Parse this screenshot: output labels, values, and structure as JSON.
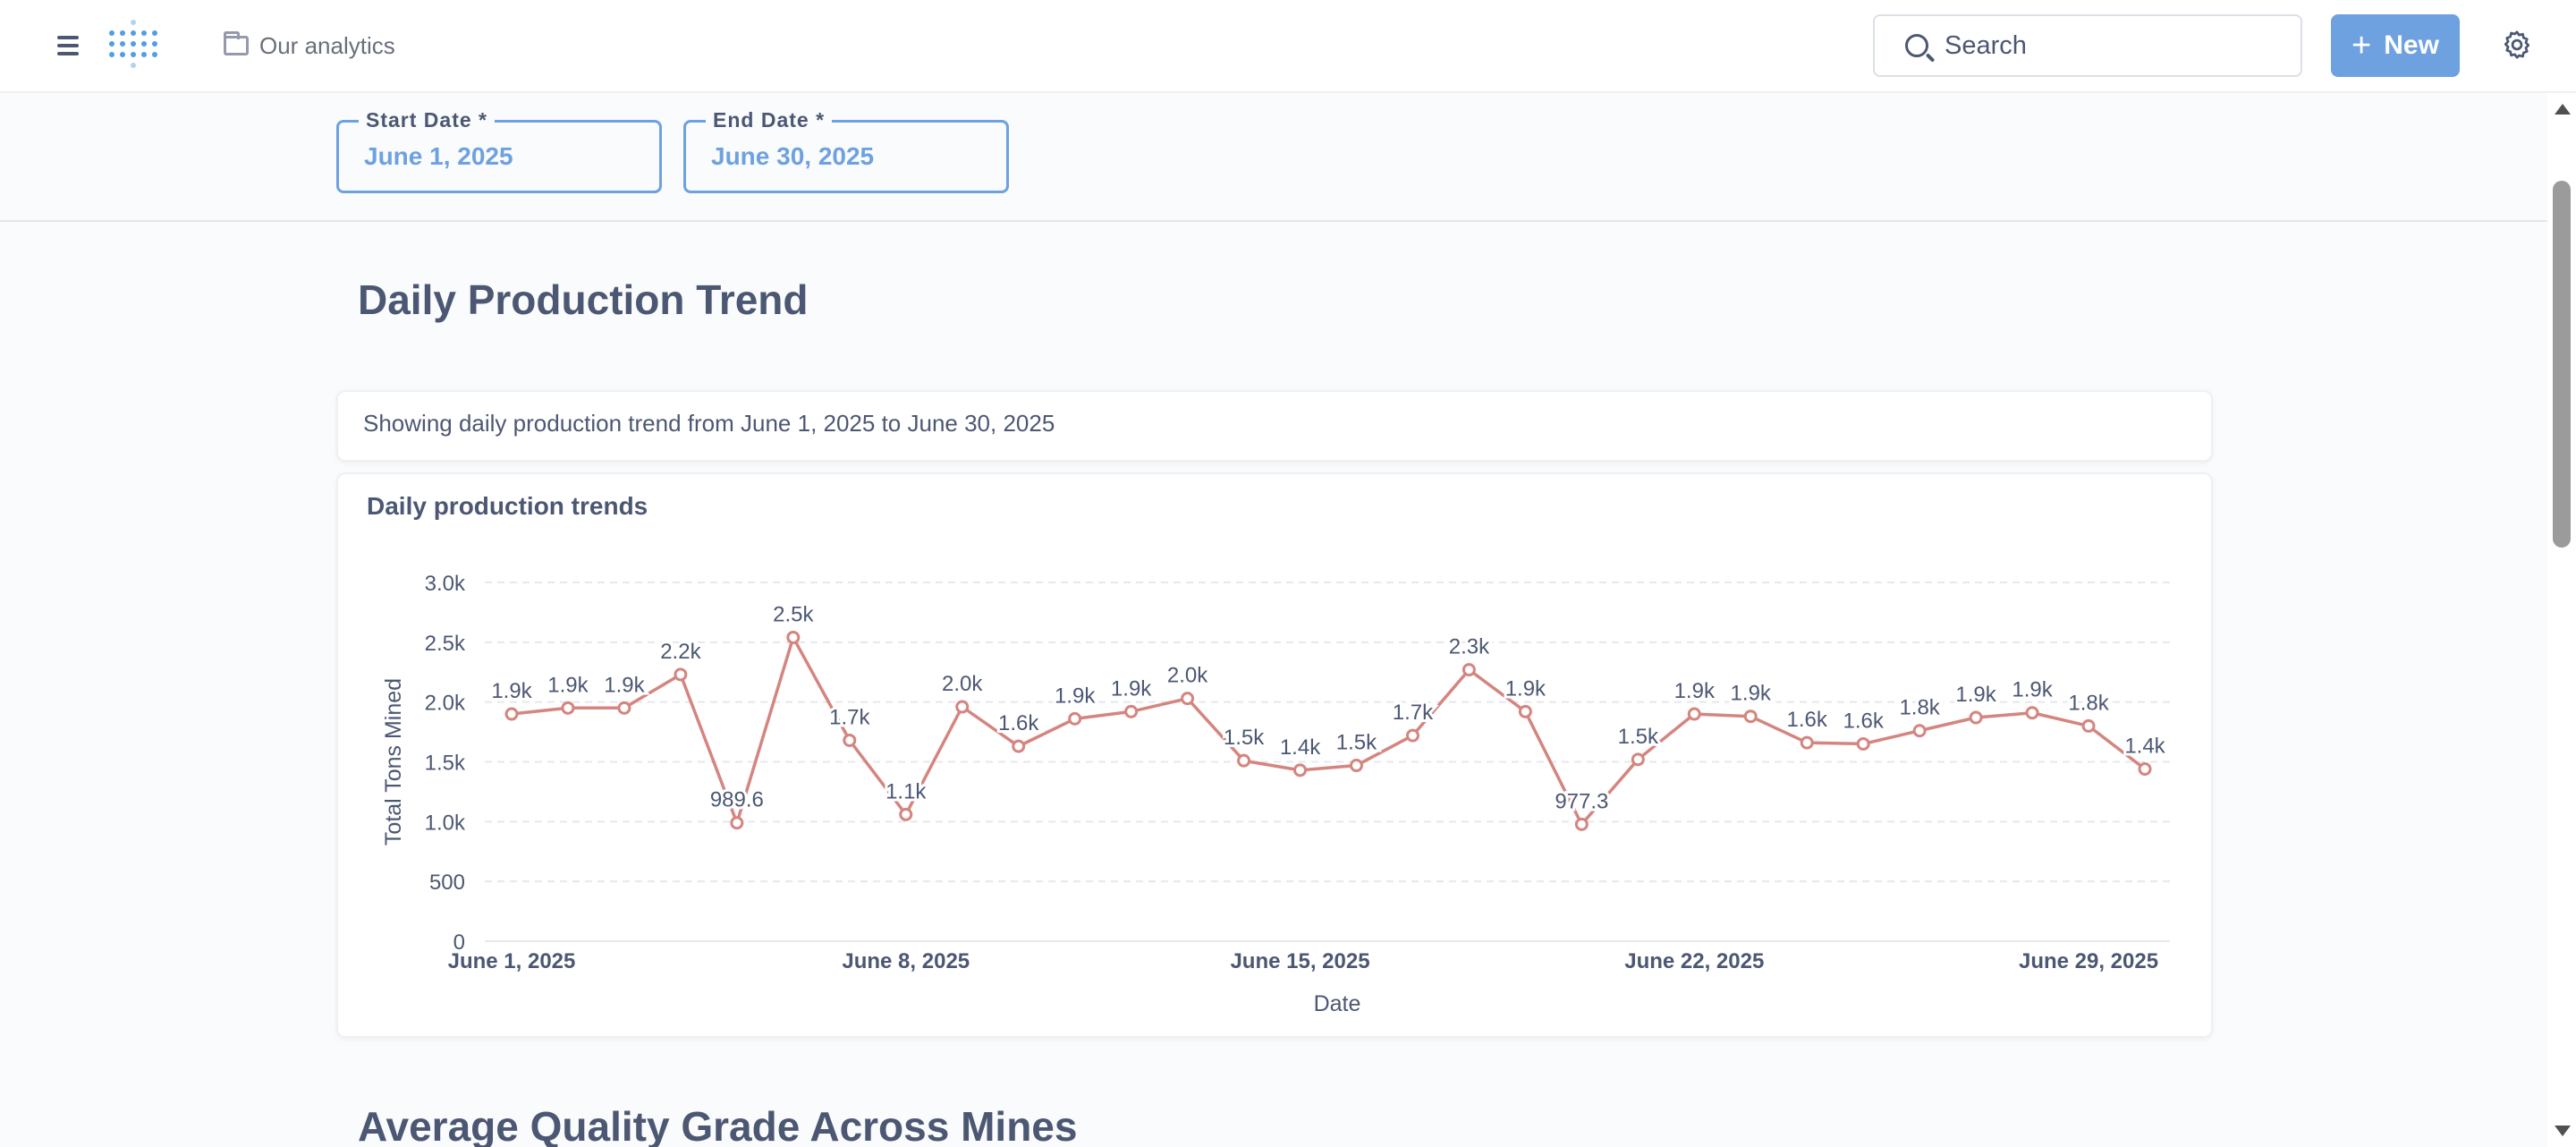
{
  "nav": {
    "breadcrumb": "Our analytics",
    "search_placeholder": "Search",
    "new_label": "New"
  },
  "filters": {
    "start": {
      "label": "Start Date *",
      "value": "June 1, 2025"
    },
    "end": {
      "label": "End Date *",
      "value": "June 30, 2025"
    }
  },
  "dashboard": {
    "heading": "Daily Production Trend",
    "description": "Showing daily production trend from June 1, 2025 to June 30, 2025",
    "card_title": "Daily production trends",
    "next_heading": "Average Quality Grade Across Mines"
  },
  "chart_data": {
    "type": "line",
    "xlabel": "Date",
    "ylabel": "Total Tons Mined",
    "ylim": [
      0,
      3000
    ],
    "y_ticks": [
      "0",
      "500",
      "1.0k",
      "1.5k",
      "2.0k",
      "2.5k",
      "3.0k"
    ],
    "y_tick_values": [
      0,
      500,
      1000,
      1500,
      2000,
      2500,
      3000
    ],
    "x_tick_labels": [
      "June 1, 2025",
      "June 8, 2025",
      "June 15, 2025",
      "June 22, 2025",
      "June 29, 2025"
    ],
    "x_tick_days": [
      1,
      8,
      15,
      22,
      29
    ],
    "grid": true,
    "color": "#d4857f",
    "x": [
      "2025-06-01",
      "2025-06-02",
      "2025-06-03",
      "2025-06-04",
      "2025-06-05",
      "2025-06-06",
      "2025-06-07",
      "2025-06-08",
      "2025-06-09",
      "2025-06-10",
      "2025-06-11",
      "2025-06-12",
      "2025-06-13",
      "2025-06-14",
      "2025-06-15",
      "2025-06-16",
      "2025-06-17",
      "2025-06-18",
      "2025-06-19",
      "2025-06-20",
      "2025-06-21",
      "2025-06-22",
      "2025-06-23",
      "2025-06-24",
      "2025-06-25",
      "2025-06-26",
      "2025-06-27",
      "2025-06-28",
      "2025-06-29",
      "2025-06-30"
    ],
    "values": [
      1900,
      1950,
      1950,
      2230,
      989.6,
      2540,
      1680,
      1060,
      1960,
      1630,
      1860,
      1920,
      2030,
      1510,
      1430,
      1470,
      1720,
      2270,
      1920,
      977.3,
      1520,
      1900,
      1880,
      1660,
      1650,
      1760,
      1870,
      1910,
      1800,
      1440
    ],
    "data_labels": [
      "1.9k",
      "1.9k",
      "1.9k",
      "2.2k",
      "989.6",
      "2.5k",
      "1.7k",
      "1.1k",
      "2.0k",
      "1.6k",
      "1.9k",
      "1.9k",
      "2.0k",
      "1.5k",
      "1.4k",
      "1.5k",
      "1.7k",
      "2.3k",
      "1.9k",
      "977.3",
      "1.5k",
      "1.9k",
      "1.9k",
      "1.6k",
      "1.6k",
      "1.8k",
      "1.9k",
      "1.9k",
      "1.8k",
      "1.4k"
    ]
  }
}
